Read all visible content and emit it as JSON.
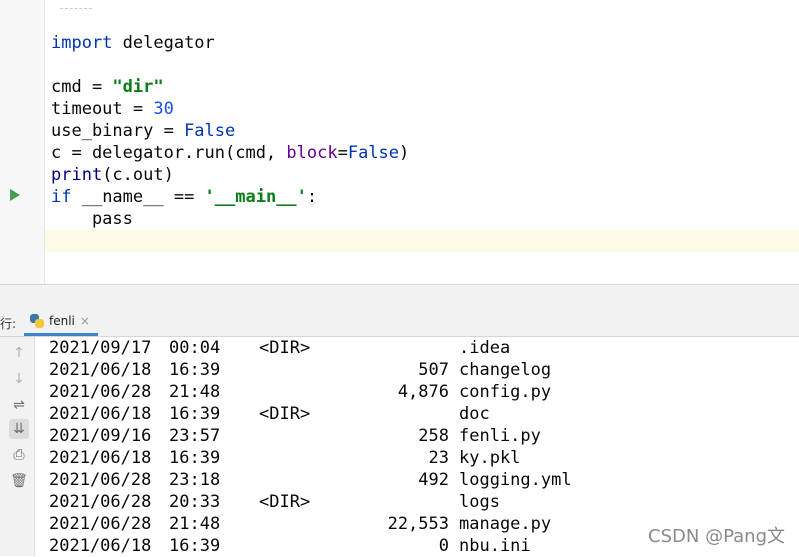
{
  "editor": {
    "lines": [
      [
        {
          "t": "import",
          "c": "kw"
        },
        {
          "t": " delegator"
        }
      ],
      [
        {
          "t": ""
        }
      ],
      [
        {
          "t": "cmd = "
        },
        {
          "t": "\"dir\"",
          "c": "str"
        }
      ],
      [
        {
          "t": "timeout = "
        },
        {
          "t": "30",
          "c": "num"
        }
      ],
      [
        {
          "t": "use_binary = "
        },
        {
          "t": "False",
          "c": "kw"
        }
      ],
      [
        {
          "t": "c = delegator.run(cmd, "
        },
        {
          "t": "block",
          "c": "param"
        },
        {
          "t": "="
        },
        {
          "t": "False",
          "c": "kw"
        },
        {
          "t": ")"
        }
      ],
      [
        {
          "t": "print",
          "c": "builtin"
        },
        {
          "t": "(c.out)"
        }
      ],
      [
        {
          "t": "if",
          "c": "kw"
        },
        {
          "t": " __name__ == "
        },
        {
          "t": "'__main__'",
          "c": "str"
        },
        {
          "t": ":"
        }
      ],
      [
        {
          "t": "    pass"
        }
      ]
    ]
  },
  "tool_window": {
    "label": "行:",
    "tab_label": "fenli",
    "close_glyph": "×"
  },
  "icons": {
    "up": "↑",
    "down": "↓",
    "soft_wrap": "⇌",
    "scroll_to_end": "⇊",
    "print": "⎙",
    "clear": "🗑"
  },
  "console": {
    "rows": [
      {
        "date": "2021/09/17",
        "time": "00:04",
        "dir": "<DIR>",
        "size": "",
        "name": ".idea"
      },
      {
        "date": "2021/06/18",
        "time": "16:39",
        "dir": "",
        "size": "507",
        "name": "changelog"
      },
      {
        "date": "2021/06/28",
        "time": "21:48",
        "dir": "",
        "size": "4,876",
        "name": "config.py"
      },
      {
        "date": "2021/06/18",
        "time": "16:39",
        "dir": "<DIR>",
        "size": "",
        "name": "doc"
      },
      {
        "date": "2021/09/16",
        "time": "23:57",
        "dir": "",
        "size": "258",
        "name": "fenli.py"
      },
      {
        "date": "2021/06/18",
        "time": "16:39",
        "dir": "",
        "size": "23",
        "name": "ky.pkl"
      },
      {
        "date": "2021/06/28",
        "time": "23:18",
        "dir": "",
        "size": "492",
        "name": "logging.yml"
      },
      {
        "date": "2021/06/28",
        "time": "20:33",
        "dir": "<DIR>",
        "size": "",
        "name": "logs"
      },
      {
        "date": "2021/06/28",
        "time": "21:48",
        "dir": "",
        "size": "22,553",
        "name": "manage.py"
      },
      {
        "date": "2021/06/18",
        "time": "16:39",
        "dir": "",
        "size": "0",
        "name": "nbu.ini"
      }
    ]
  },
  "watermark": "CSDN @Pang文"
}
